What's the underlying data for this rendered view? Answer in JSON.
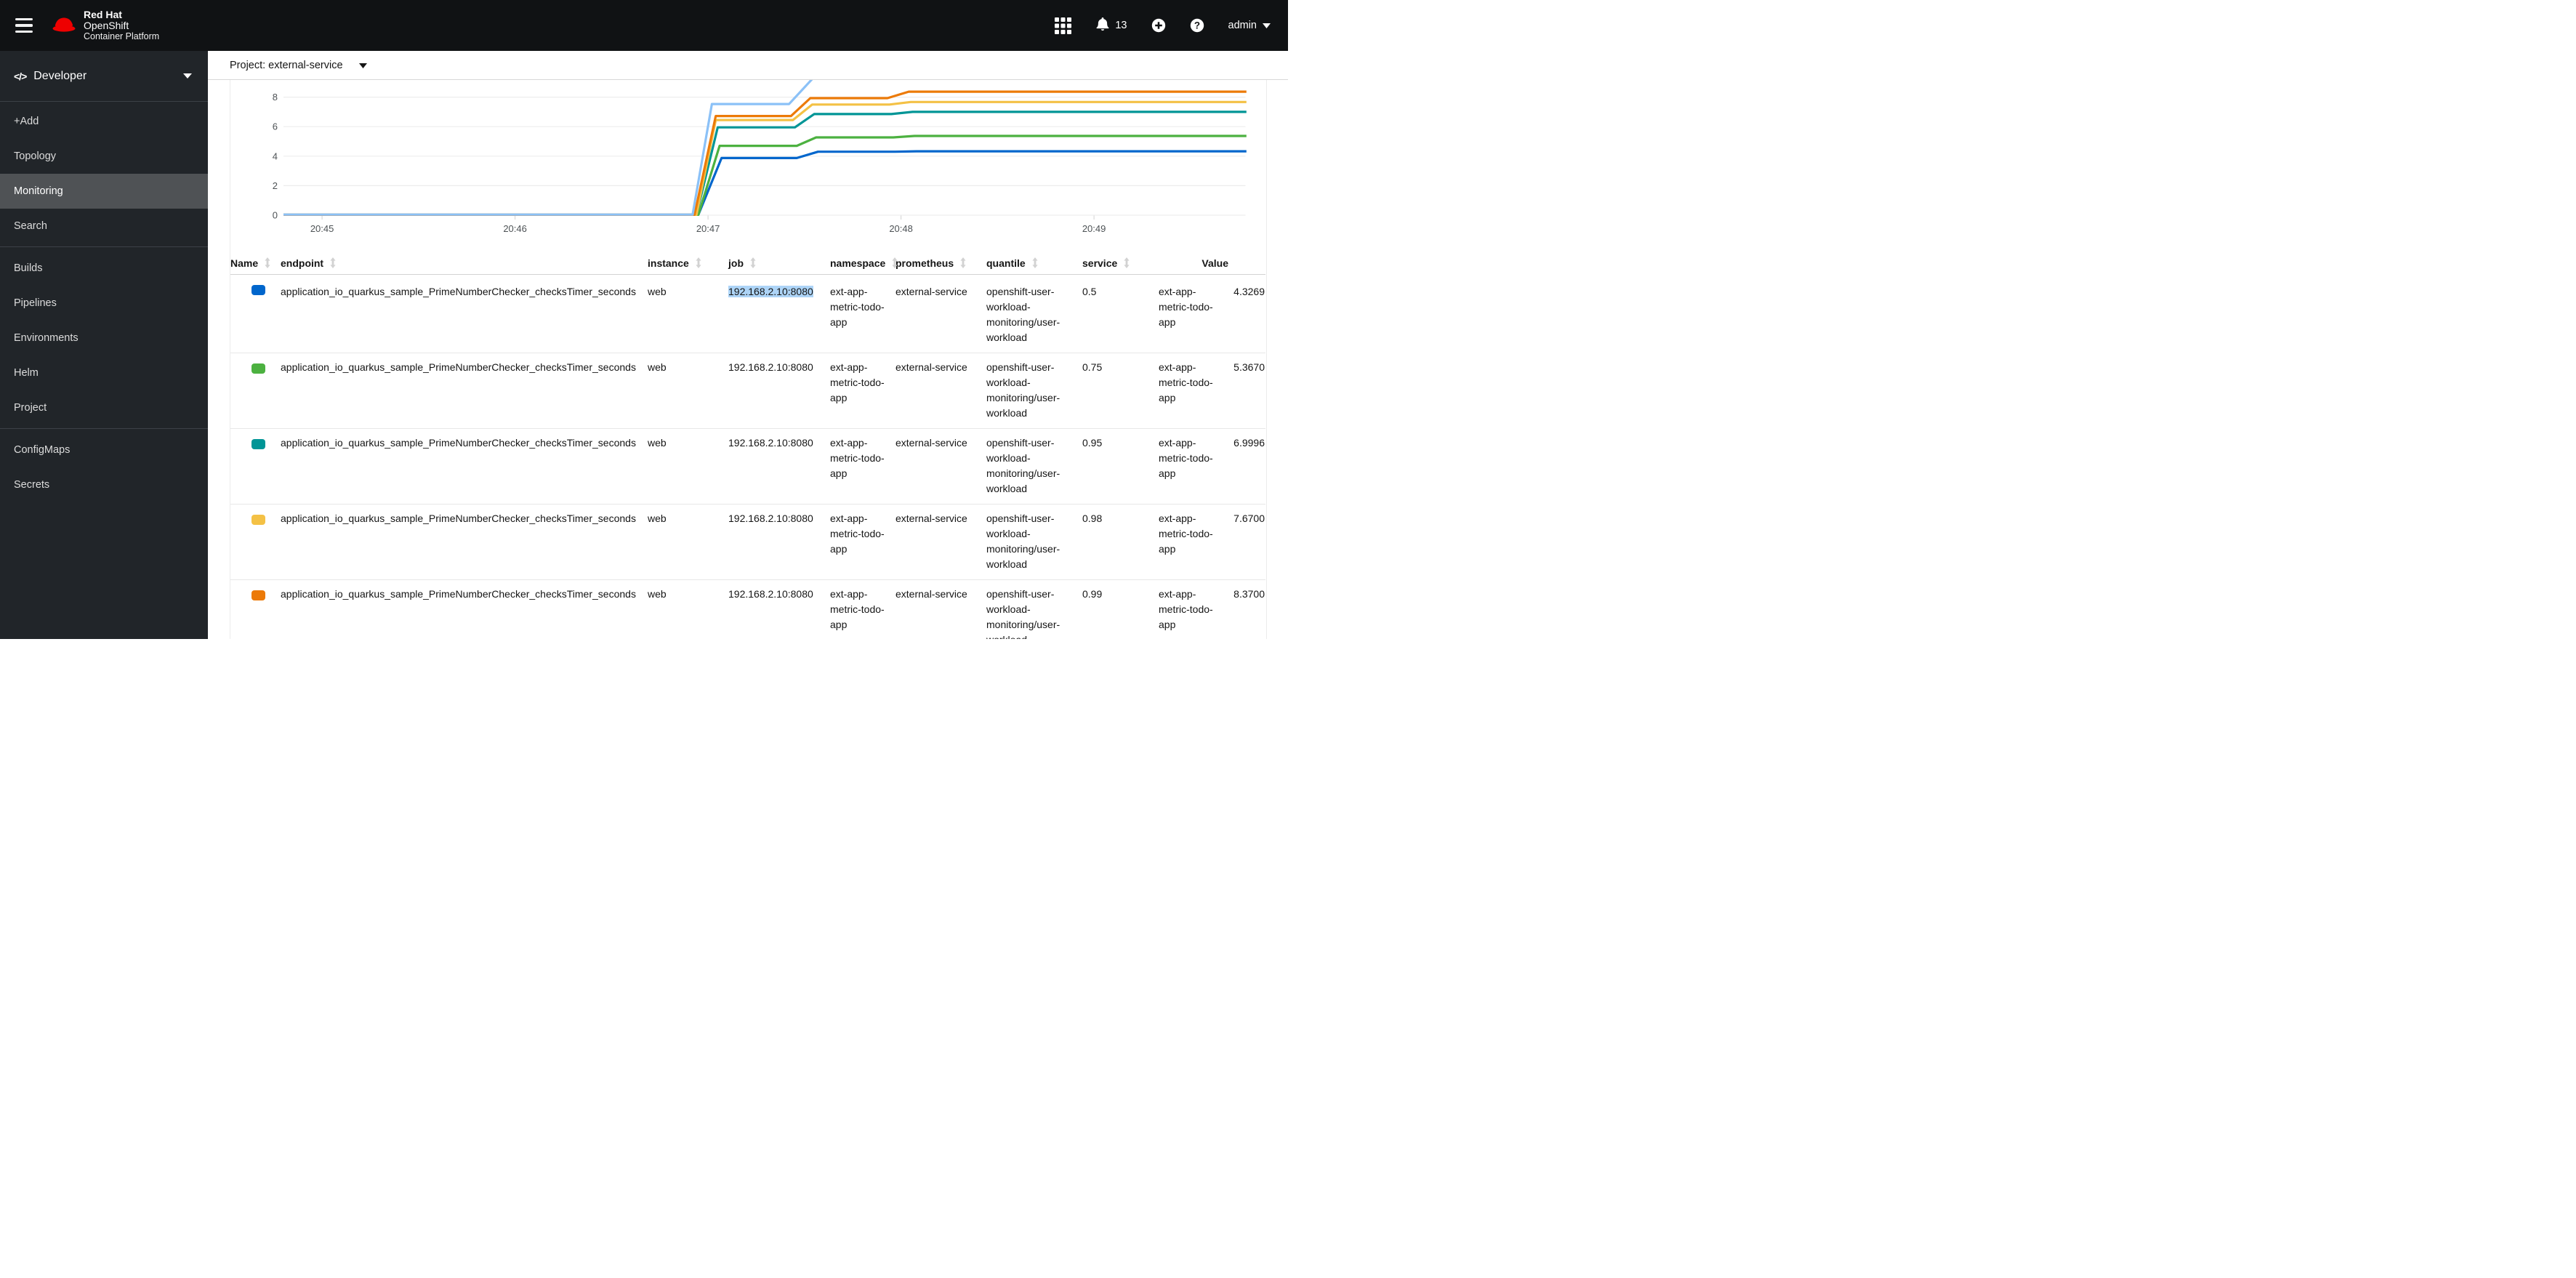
{
  "masthead": {
    "brand_line1": "Red Hat",
    "brand_line2": "OpenShift",
    "brand_line3": "Container Platform",
    "notification_count": "13",
    "username": "admin"
  },
  "sidebar": {
    "perspective": "Developer",
    "active_item": "Monitoring",
    "groups": [
      {
        "items": [
          "+Add",
          "Topology",
          "Monitoring",
          "Search"
        ]
      },
      {
        "items": [
          "Builds",
          "Pipelines",
          "Environments",
          "Helm",
          "Project"
        ]
      },
      {
        "items": [
          "ConfigMaps",
          "Secrets"
        ]
      }
    ]
  },
  "toolbar": {
    "project_selector": "Project: external-service"
  },
  "chart_data": {
    "type": "line",
    "title": "",
    "xlabel": "",
    "ylabel": "",
    "x_unit": "clock time; x values below are minutes past 20:00",
    "grid": true,
    "legend": "none (series correspond to table rows by color)",
    "x_ticks": [
      {
        "m": 45,
        "label": "20:45"
      },
      {
        "m": 46,
        "label": "20:46"
      },
      {
        "m": 47,
        "label": "20:47"
      },
      {
        "m": 48,
        "label": "20:48"
      },
      {
        "m": 49,
        "label": "20:49"
      }
    ],
    "y_ticks": [
      0,
      2,
      4,
      6,
      8
    ],
    "ylim_visible": [
      0,
      9.2
    ],
    "xlim": [
      44.8,
      49.79
    ],
    "series": [
      {
        "name": "quantile 0.5",
        "color": "#0066cc",
        "points": [
          [
            44.8,
            0.03
          ],
          [
            46.95,
            0.03
          ],
          [
            47.07,
            3.87
          ],
          [
            47.46,
            3.87
          ],
          [
            47.57,
            4.3
          ],
          [
            47.97,
            4.3
          ],
          [
            48.08,
            4.33
          ],
          [
            49.79,
            4.33
          ]
        ]
      },
      {
        "name": "quantile 0.75",
        "color": "#4cb140",
        "points": [
          [
            44.8,
            0.03
          ],
          [
            46.95,
            0.03
          ],
          [
            47.06,
            4.7
          ],
          [
            47.46,
            4.7
          ],
          [
            47.56,
            5.27
          ],
          [
            47.96,
            5.27
          ],
          [
            48.07,
            5.37
          ],
          [
            49.79,
            5.37
          ]
        ]
      },
      {
        "name": "quantile 0.95",
        "color": "#009596",
        "points": [
          [
            44.8,
            0.03
          ],
          [
            46.94,
            0.03
          ],
          [
            47.05,
            5.95
          ],
          [
            47.45,
            5.95
          ],
          [
            47.55,
            6.85
          ],
          [
            47.95,
            6.85
          ],
          [
            48.06,
            7.0
          ],
          [
            49.79,
            7.0
          ]
        ]
      },
      {
        "name": "quantile 0.98",
        "color": "#f4c145",
        "points": [
          [
            44.8,
            0.03
          ],
          [
            46.94,
            0.03
          ],
          [
            47.04,
            6.45
          ],
          [
            47.44,
            6.45
          ],
          [
            47.54,
            7.5
          ],
          [
            47.94,
            7.5
          ],
          [
            48.05,
            7.67
          ],
          [
            49.79,
            7.67
          ]
        ]
      },
      {
        "name": "quantile 0.99",
        "color": "#ec7a08",
        "points": [
          [
            44.8,
            0.03
          ],
          [
            46.93,
            0.03
          ],
          [
            47.04,
            6.72
          ],
          [
            47.43,
            6.72
          ],
          [
            47.53,
            7.93
          ],
          [
            47.93,
            7.93
          ],
          [
            48.04,
            8.37
          ],
          [
            49.79,
            8.37
          ]
        ]
      },
      {
        "name": "upper series (clipped at top of visible area)",
        "color": "#8bc1f7",
        "points": [
          [
            44.8,
            0.04
          ],
          [
            46.92,
            0.04
          ],
          [
            47.02,
            7.53
          ],
          [
            47.42,
            7.53
          ],
          [
            47.58,
            9.8
          ]
        ]
      }
    ]
  },
  "table": {
    "columns": [
      {
        "key": "name",
        "label": "Name",
        "sortable": true
      },
      {
        "key": "endpoint",
        "label": "endpoint",
        "sortable": true
      },
      {
        "key": "instance",
        "label": "instance",
        "sortable": true
      },
      {
        "key": "job",
        "label": "job",
        "sortable": true
      },
      {
        "key": "namespace",
        "label": "namespace",
        "sortable": true
      },
      {
        "key": "prometheus",
        "label": "prometheus",
        "sortable": true
      },
      {
        "key": "quantile",
        "label": "quantile",
        "sortable": true
      },
      {
        "key": "service",
        "label": "service",
        "sortable": true
      },
      {
        "key": "value",
        "label": "Value",
        "sortable": false
      }
    ],
    "rows": [
      {
        "color": "#0066cc",
        "name": "application_io_quarkus_sample_PrimeNumberChecker_checksTimer_seconds",
        "endpoint": "web",
        "instance": "192.168.2.10:8080",
        "instance_selected": true,
        "job": "ext-app-metric-todo-app",
        "namespace": "external-service",
        "prometheus": "openshift-user-workload-monitoring/user-workload",
        "quantile": "0.5",
        "service": "ext-app-metric-todo-app",
        "value": "4.3269"
      },
      {
        "color": "#4cb140",
        "name": "application_io_quarkus_sample_PrimeNumberChecker_checksTimer_seconds",
        "endpoint": "web",
        "instance": "192.168.2.10:8080",
        "instance_selected": false,
        "job": "ext-app-metric-todo-app",
        "namespace": "external-service",
        "prometheus": "openshift-user-workload-monitoring/user-workload",
        "quantile": "0.75",
        "service": "ext-app-metric-todo-app",
        "value": "5.3670"
      },
      {
        "color": "#009596",
        "name": "application_io_quarkus_sample_PrimeNumberChecker_checksTimer_seconds",
        "endpoint": "web",
        "instance": "192.168.2.10:8080",
        "instance_selected": false,
        "job": "ext-app-metric-todo-app",
        "namespace": "external-service",
        "prometheus": "openshift-user-workload-monitoring/user-workload",
        "quantile": "0.95",
        "service": "ext-app-metric-todo-app",
        "value": "6.9996"
      },
      {
        "color": "#f4c145",
        "name": "application_io_quarkus_sample_PrimeNumberChecker_checksTimer_seconds",
        "endpoint": "web",
        "instance": "192.168.2.10:8080",
        "instance_selected": false,
        "job": "ext-app-metric-todo-app",
        "namespace": "external-service",
        "prometheus": "openshift-user-workload-monitoring/user-workload",
        "quantile": "0.98",
        "service": "ext-app-metric-todo-app",
        "value": "7.6700"
      },
      {
        "color": "#ec7a08",
        "name": "application_io_quarkus_sample_PrimeNumberChecker_checksTimer_seconds",
        "endpoint": "web",
        "instance": "192.168.2.10:8080",
        "instance_selected": false,
        "job": "ext-app-metric-todo-app",
        "namespace": "external-service",
        "prometheus": "openshift-user-workload-monitoring/user-workload",
        "quantile": "0.99",
        "service": "ext-app-metric-todo-app",
        "value": "8.3700"
      }
    ]
  }
}
